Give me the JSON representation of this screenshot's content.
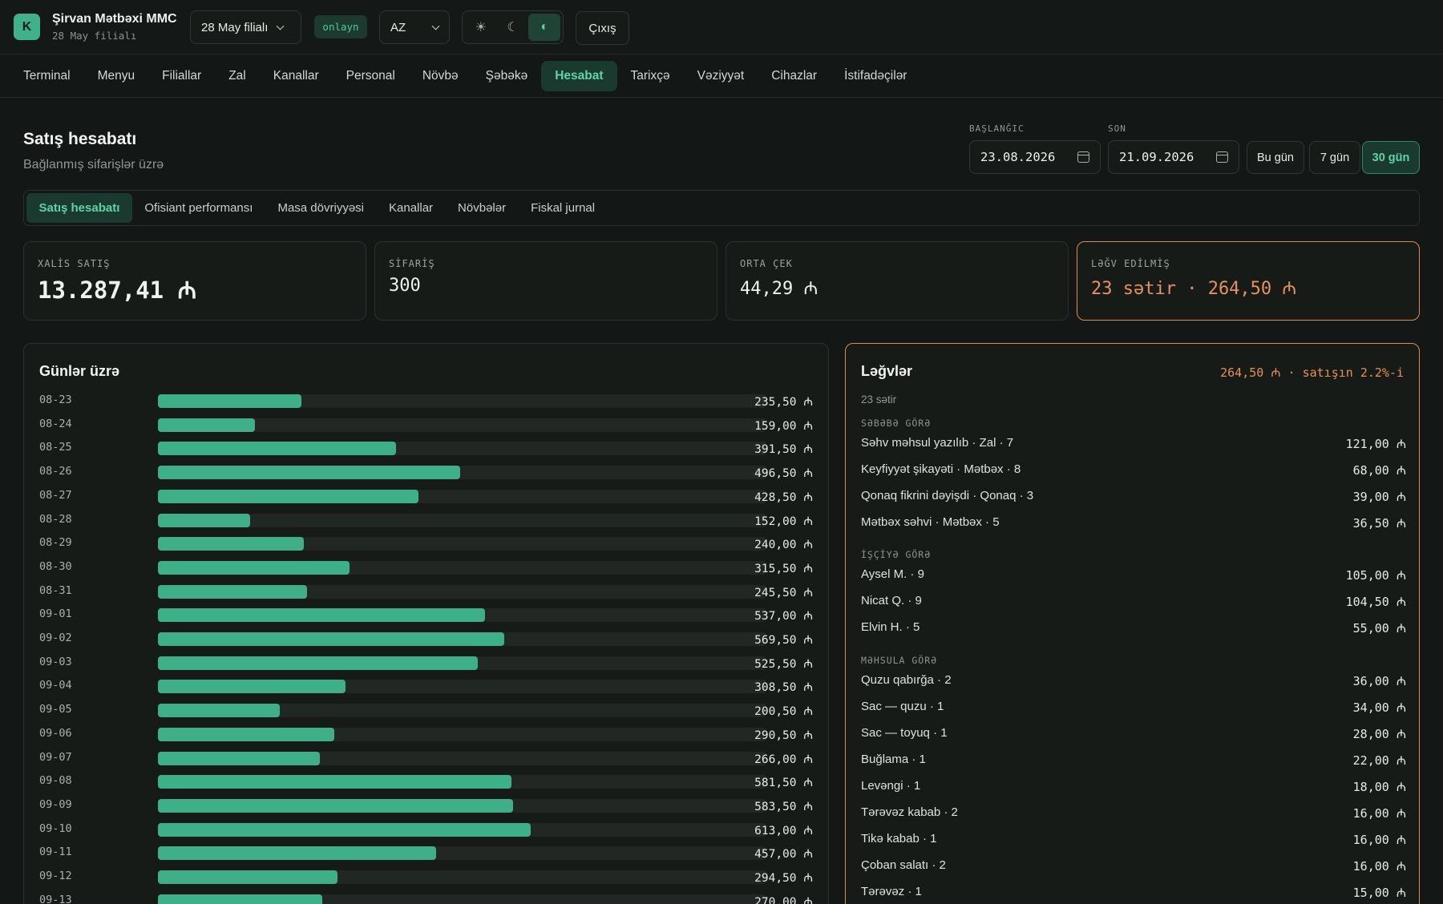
{
  "header": {
    "logo_letter": "K",
    "company_name": "Şirvan Mətbəxi MMC",
    "company_branch": "28 May filialı",
    "branch_select": "28 May filialı",
    "status": "onlayn",
    "language": "AZ",
    "theme_icons": [
      "sun-icon",
      "moon-icon",
      "contrast-icon"
    ],
    "logout_label": "Çıxış"
  },
  "nav": {
    "items": [
      "Terminal",
      "Menyu",
      "Filiallar",
      "Zal",
      "Kanallar",
      "Personal",
      "Növbə",
      "Şəbəkə",
      "Hesabat",
      "Tarixçə",
      "Vəziyyət",
      "Cihazlar",
      "İstifadəçilər"
    ],
    "active": "Hesabat"
  },
  "page": {
    "title": "Satış hesabatı",
    "subtitle": "Bağlanmış sifarişlər üzrə",
    "start_label": "BAŞLANĞIC",
    "start_date": "23.08.2026",
    "end_label": "SON",
    "end_date": "21.09.2026",
    "ranges": [
      "Bu gün",
      "7 gün",
      "30 gün"
    ],
    "active_range": "30 gün"
  },
  "subtabs": {
    "items": [
      "Satış hesabatı",
      "Ofisiant performansı",
      "Masa dövriyyəsi",
      "Kanallar",
      "Növbələr",
      "Fiskal jurnal"
    ],
    "active": "Satış hesabatı"
  },
  "kpis": [
    {
      "label": "XALİS SATIŞ",
      "value": "13.287,41 ₼"
    },
    {
      "label": "SİFARİŞ",
      "value": "300"
    },
    {
      "label": "ORTA ÇEK",
      "value": "44,29 ₼"
    },
    {
      "label": "LƏĞV EDİLMİŞ",
      "value": "23 sətir · 264,50 ₼"
    }
  ],
  "daily": {
    "title": "Günlər üzrə",
    "max": 1000,
    "rows": [
      {
        "day": "08-23",
        "amount": 235.5,
        "label": "235,50 ₼"
      },
      {
        "day": "08-24",
        "amount": 159.0,
        "label": "159,00 ₼"
      },
      {
        "day": "08-25",
        "amount": 391.5,
        "label": "391,50 ₼"
      },
      {
        "day": "08-26",
        "amount": 496.5,
        "label": "496,50 ₼"
      },
      {
        "day": "08-27",
        "amount": 428.5,
        "label": "428,50 ₼"
      },
      {
        "day": "08-28",
        "amount": 152.0,
        "label": "152,00 ₼"
      },
      {
        "day": "08-29",
        "amount": 240.0,
        "label": "240,00 ₼"
      },
      {
        "day": "08-30",
        "amount": 315.5,
        "label": "315,50 ₼"
      },
      {
        "day": "08-31",
        "amount": 245.5,
        "label": "245,50 ₼"
      },
      {
        "day": "09-01",
        "amount": 537.0,
        "label": "537,00 ₼"
      },
      {
        "day": "09-02",
        "amount": 569.5,
        "label": "569,50 ₼"
      },
      {
        "day": "09-03",
        "amount": 525.5,
        "label": "525,50 ₼"
      },
      {
        "day": "09-04",
        "amount": 308.5,
        "label": "308,50 ₼"
      },
      {
        "day": "09-05",
        "amount": 200.5,
        "label": "200,50 ₼"
      },
      {
        "day": "09-06",
        "amount": 290.5,
        "label": "290,50 ₼"
      },
      {
        "day": "09-07",
        "amount": 266.0,
        "label": "266,00 ₼"
      },
      {
        "day": "09-08",
        "amount": 581.5,
        "label": "581,50 ₼"
      },
      {
        "day": "09-09",
        "amount": 583.5,
        "label": "583,50 ₼"
      },
      {
        "day": "09-10",
        "amount": 613.0,
        "label": "613,00 ₼"
      },
      {
        "day": "09-11",
        "amount": 457.0,
        "label": "457,00 ₼"
      },
      {
        "day": "09-12",
        "amount": 294.5,
        "label": "294,50 ₼"
      },
      {
        "day": "09-13",
        "amount": 270.0,
        "label": "270,00 ₼"
      }
    ]
  },
  "cancellations": {
    "title": "Ləğvlər",
    "total": "264,50 ₼ · satışın 2.2%-i",
    "count": "23 sətir",
    "by_reason": {
      "label": "SƏBƏBƏ GÖRƏ",
      "rows": [
        {
          "name": "Səhv məhsul yazılıb · Zal · 7",
          "value": "121,00 ₼"
        },
        {
          "name": "Keyfiyyət şikayəti · Mətbəx · 8",
          "value": "68,00 ₼"
        },
        {
          "name": "Qonaq fikrini dəyişdi · Qonaq · 3",
          "value": "39,00 ₼"
        },
        {
          "name": "Mətbəx səhvi · Mətbəx · 5",
          "value": "36,50 ₼"
        }
      ]
    },
    "by_staff": {
      "label": "İŞÇİYƏ GÖRƏ",
      "rows": [
        {
          "name": "Aysel M. · 9",
          "value": "105,00 ₼"
        },
        {
          "name": "Nicat Q. · 9",
          "value": "104,50 ₼"
        },
        {
          "name": "Elvin H. · 5",
          "value": "55,00 ₼"
        }
      ]
    },
    "by_product": {
      "label": "MƏHSULA GÖRƏ",
      "rows": [
        {
          "name": "Quzu qabırğa · 2",
          "value": "36,00 ₼"
        },
        {
          "name": "Sac — quzu · 1",
          "value": "34,00 ₼"
        },
        {
          "name": "Sac — toyuq · 1",
          "value": "28,00 ₼"
        },
        {
          "name": "Buğlama · 1",
          "value": "22,00 ₼"
        },
        {
          "name": "Levəngi · 1",
          "value": "18,00 ₼"
        },
        {
          "name": "Tərəvəz kabab · 2",
          "value": "16,00 ₼"
        },
        {
          "name": "Tikə kabab · 1",
          "value": "16,00 ₼"
        },
        {
          "name": "Çoban salatı · 2",
          "value": "16,00 ₼"
        },
        {
          "name": "Tərəvəz · 1",
          "value": "15,00 ₼"
        }
      ]
    }
  },
  "colors": {
    "accent": "#3db08a",
    "warning": "#e8915a",
    "background": "#131715"
  }
}
